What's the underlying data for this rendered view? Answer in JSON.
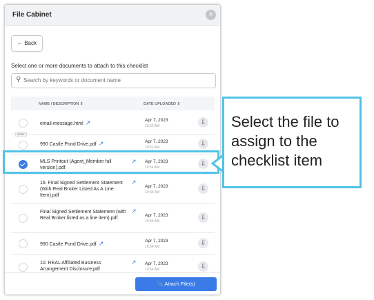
{
  "modal": {
    "title": "File Cabinet",
    "close_label": "×",
    "back_label": "← Back",
    "instruction": "Select one or more documents to attach to this checklist",
    "search": {
      "placeholder": "Search by keywords or document name",
      "value": ""
    },
    "columns": [
      "NAME / DESCRIPTION ⇕",
      "DATE UPLOADED ⇕"
    ],
    "slider_tag": "slider",
    "rows": [
      {
        "name": "email-message.html",
        "date": "Apr 7, 2023",
        "time": "10:52 AM",
        "selected": false
      },
      {
        "name": "990 Castle Pond Drive.pdf",
        "date": "Apr 7, 2023",
        "time": "10:52 AM",
        "selected": false
      },
      {
        "name": "MLS Printout (Agent_Member full version).pdf",
        "date": "Apr 7, 2023",
        "time": "10:54 AM",
        "selected": true
      },
      {
        "name": "16. Final Signed Settlement Statement (With Real Broker Listed As A Line Item).pdf",
        "date": "Apr 7, 2023",
        "time": "10:54 AM",
        "selected": false
      },
      {
        "name": "Final Signed Settlement Statement (with Real Broker listed as a line item).pdf",
        "date": "Apr 7, 2023",
        "time": "10:54 AM",
        "selected": false
      },
      {
        "name": "990 Castle Pond Drive.pdf",
        "date": "Apr 7, 2023",
        "time": "10:54 AM",
        "selected": false
      },
      {
        "name": "10. REAL Affiliated Business Arrangement Disclosure.pdf",
        "date": "Apr 7, 2023",
        "time": "10:54 AM",
        "selected": false
      }
    ],
    "attach_label": "Attach File(s)",
    "icons": {
      "search": "search-icon",
      "close": "close-icon",
      "external": "external-link-icon",
      "download": "cloud-download-icon",
      "attach": "paperclip-icon"
    }
  },
  "callout": {
    "text": "Select the file to assign to the checklist item"
  },
  "colors": {
    "accent": "#3b7be8",
    "highlight": "#4fc3e6"
  }
}
